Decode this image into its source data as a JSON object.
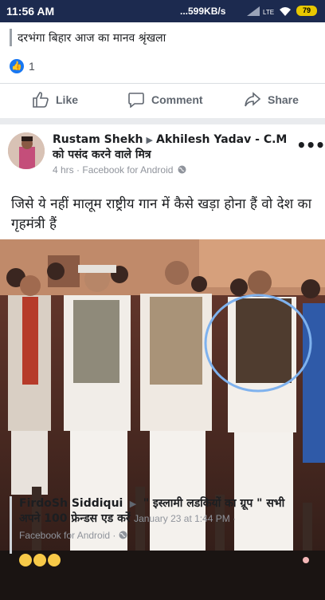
{
  "status_bar": {
    "time": "11:56 AM",
    "net_speed": "...599KB/s",
    "battery": "79"
  },
  "prev_post": {
    "text": "दरभंगा बिहार आज का मानव श्रृंखला",
    "reaction_count": "1",
    "actions": {
      "like": "Like",
      "comment": "Comment",
      "share": "Share"
    }
  },
  "post": {
    "author": "Rustam Shekh",
    "target": "Akhilesh Yadav - C.M को पसंद करने वाले मित्र",
    "time": "4 hrs",
    "source": "Facebook for Android",
    "text": "जिसे ये नहीं मालूम राष्ट्रीय गान में कैसे खड़ा होना हैं वो देश का गृहमंत्री हैं"
  },
  "shared_post": {
    "author": "FirdoSh Siddiqui",
    "target": "\" इस्लामी लडकियों का ग्रूप \" सभी अपने 100 फ्रेन्डस एड करें",
    "date": "January 23 at 1:44 PM",
    "source": "Facebook for Android"
  },
  "colors": {
    "status_bar": "#1c2a4f",
    "link_blue": "#1877f2",
    "highlight_circle": "#7fb2ee"
  }
}
